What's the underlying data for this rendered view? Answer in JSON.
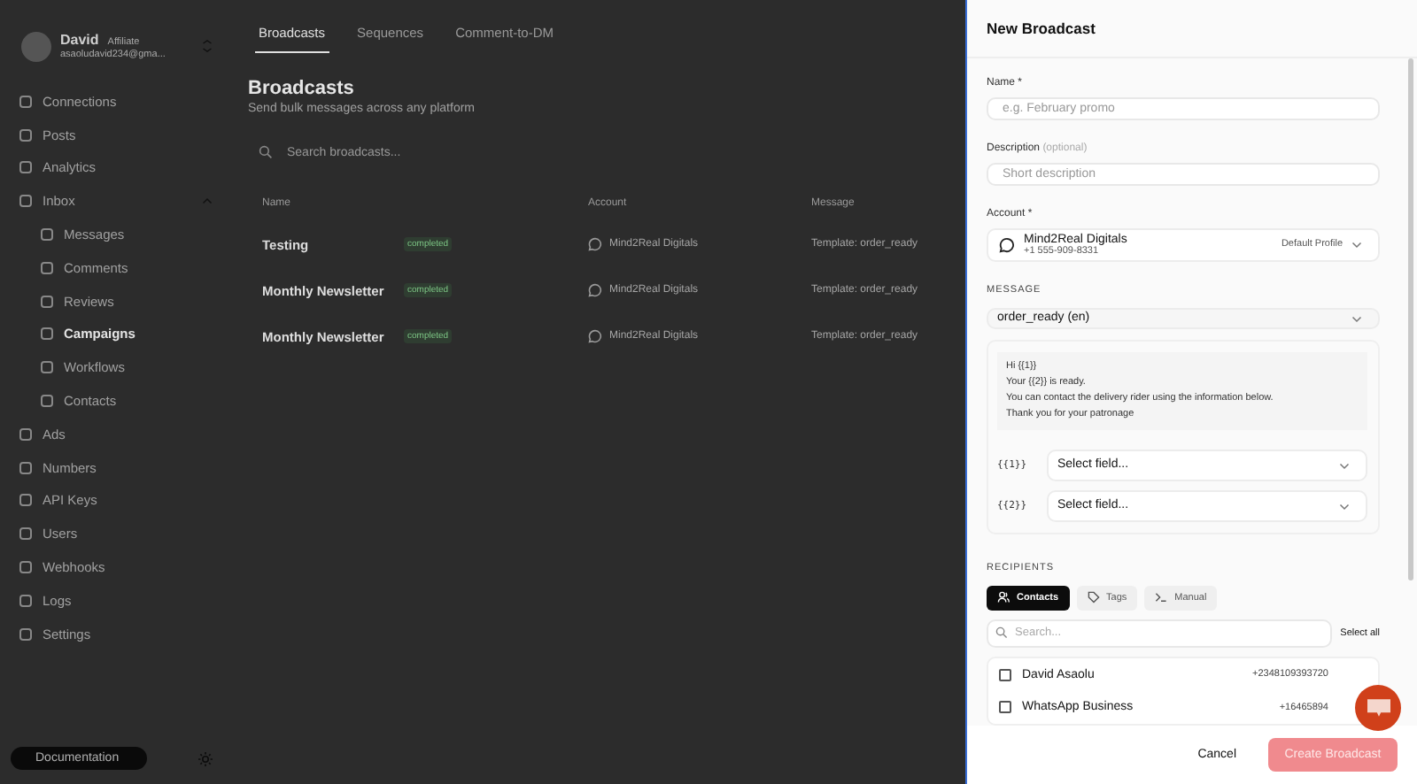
{
  "profile": {
    "name": "David",
    "role": "Affiliate",
    "email": "asaoludavid234@gma..."
  },
  "sidebar": {
    "items": [
      {
        "label": "Connections",
        "selected": false
      },
      {
        "label": "Posts",
        "selected": false
      },
      {
        "label": "Analytics",
        "selected": false
      },
      {
        "label": "Inbox",
        "selected": false,
        "expanded": true,
        "children": [
          {
            "label": "Messages",
            "selected": false
          },
          {
            "label": "Comments",
            "selected": false
          },
          {
            "label": "Reviews",
            "selected": false
          },
          {
            "label": "Campaigns",
            "selected": true
          },
          {
            "label": "Workflows",
            "selected": false
          },
          {
            "label": "Contacts",
            "selected": false
          }
        ]
      },
      {
        "label": "Ads",
        "selected": false
      },
      {
        "label": "Numbers",
        "selected": false
      },
      {
        "label": "API Keys",
        "selected": false
      },
      {
        "label": "Users",
        "selected": false
      },
      {
        "label": "Webhooks",
        "selected": false
      },
      {
        "label": "Logs",
        "selected": false
      },
      {
        "label": "Settings",
        "selected": false
      }
    ],
    "docs_button": "Documentation"
  },
  "tabs": [
    {
      "label": "Broadcasts",
      "selected": true
    },
    {
      "label": "Sequences",
      "selected": false
    },
    {
      "label": "Comment-to-DM",
      "selected": false
    }
  ],
  "page": {
    "title": "Broadcasts",
    "subtitle": "Send bulk messages across any platform",
    "search": {
      "placeholder": "Search broadcasts..."
    }
  },
  "table": {
    "columns": [
      "Name",
      "Account",
      "Message"
    ],
    "rows": [
      {
        "name": "Testing",
        "status": "completed",
        "account": "Mind2Real Digitals",
        "message": "Template: order_ready"
      },
      {
        "name": "Monthly Newsletter",
        "status": "completed",
        "account": "Mind2Real Digitals",
        "message": "Template: order_ready"
      },
      {
        "name": "Monthly Newsletter",
        "status": "completed",
        "account": "Mind2Real Digitals",
        "message": "Template: order_ready"
      }
    ]
  },
  "panel": {
    "title": "New Broadcast",
    "name_field": {
      "label": "Name *",
      "placeholder": "e.g. February promo"
    },
    "description_field": {
      "label": "Description",
      "hint": "(optional)",
      "placeholder": "Short description"
    },
    "account": {
      "label": "Account *",
      "name": "Mind2Real Digitals",
      "phone": "+1 555-909-8331",
      "profile": "Default Profile"
    },
    "message": {
      "heading": "MESSAGE",
      "template": "order_ready (en)",
      "preview": [
        "Hi {{1}}",
        "Your {{2}} is ready.",
        "You can contact the delivery rider using the information below.",
        "Thank you for your patronage"
      ],
      "variables": [
        {
          "token": "{{1}}",
          "placeholder": "Select field..."
        },
        {
          "token": "{{2}}",
          "placeholder": "Select field..."
        }
      ]
    },
    "recipients": {
      "heading": "RECIPIENTS",
      "tabs": [
        {
          "label": "Contacts",
          "selected": true
        },
        {
          "label": "Tags",
          "selected": false
        },
        {
          "label": "Manual",
          "selected": false
        }
      ],
      "search": {
        "placeholder": "Search..."
      },
      "select_all": "Select all",
      "contacts": [
        {
          "name": "David Asaolu",
          "phone": "+2348109393720",
          "checked": false
        },
        {
          "name": "WhatsApp Business",
          "phone": "+16465894",
          "checked": false
        }
      ]
    },
    "cancel": "Cancel",
    "submit": {
      "label": "Create Broadcast",
      "disabled": true
    }
  }
}
